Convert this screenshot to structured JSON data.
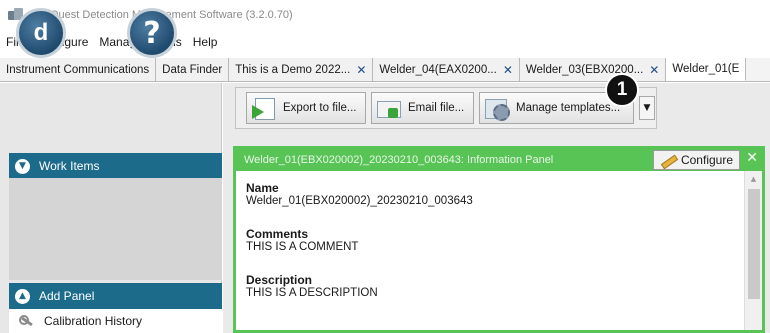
{
  "window": {
    "title": "TSI|Quest Detection Management Software (3.2.0.70)"
  },
  "menu": [
    "File",
    "Configure",
    "Manage",
    "Tools",
    "Help"
  ],
  "tabs": [
    {
      "label": "Instrument Communications",
      "closable": false
    },
    {
      "label": "Data Finder",
      "closable": false
    },
    {
      "label": "This is a Demo 2022...",
      "closable": true
    },
    {
      "label": "Welder_04(EAX0200...",
      "closable": true
    },
    {
      "label": "Welder_03(EBX0200...",
      "closable": true
    },
    {
      "label": "Welder_01(E",
      "closable": false,
      "active": true
    }
  ],
  "sidebar": {
    "logo_letter": "d",
    "help_symbol": "?",
    "work_items_label": "Work Items",
    "add_panel_label": "Add Panel",
    "calibration_history_label": "Calibration History"
  },
  "toolbar": {
    "export_label": "Export to file...",
    "email_label": "Email file...",
    "templates_label": "Manage templates...",
    "dropdown_symbol": "▼"
  },
  "callout": {
    "number": "1"
  },
  "panel": {
    "title": "Welder_01(EBX020002)_20230210_003643: Information Panel",
    "configure_label": "Configure",
    "close_symbol": "✕",
    "fields": [
      {
        "label": "Name",
        "value": "Welder_01(EBX020002)_20230210_003643"
      },
      {
        "label": "Comments",
        "value": "THIS IS A COMMENT"
      },
      {
        "label": "Description",
        "value": "THIS IS A DESCRIPTION"
      }
    ]
  },
  "colors": {
    "accent_blue": "#1d6b8b",
    "panel_green": "#58c456",
    "tab_close_blue": "#1f4e88"
  }
}
